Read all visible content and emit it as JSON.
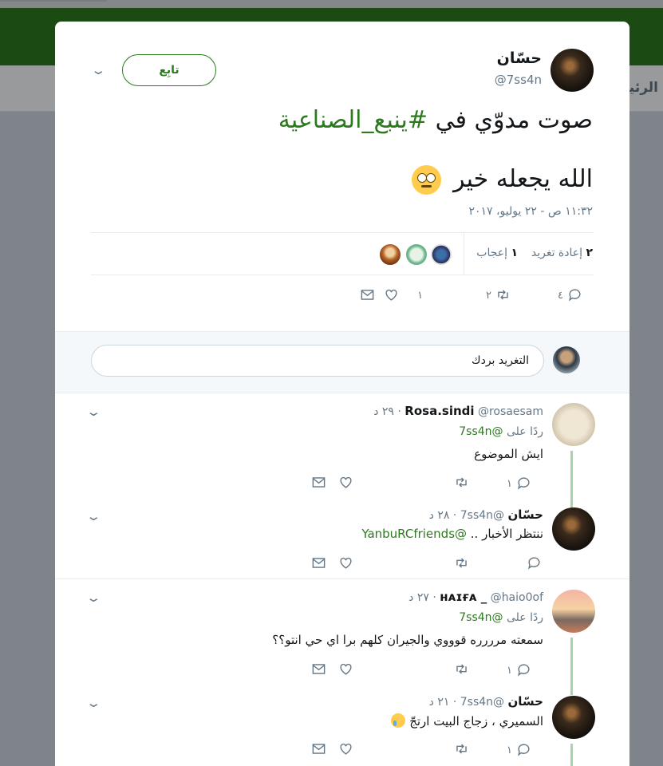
{
  "background": {
    "nav_label": "الرئيسية"
  },
  "tweet": {
    "author_name": "حسّان",
    "author_handle": "@7ss4n",
    "follow_label": "تابِع",
    "text_line1": "صوت مدوّي في ",
    "hashtag": "#ينبع_الصناعية",
    "text_line2": "الله يجعله خير",
    "timestamp": "١١:٣٢ ص - ٢٢ يوليو، ٢٠١٧",
    "retweets_count": "٢",
    "retweets_label": "إعادة تغريد",
    "likes_count": "١",
    "likes_label": "إعجاب",
    "reply_count": "٤",
    "retweet_count_action": "٢",
    "like_count_action": "١"
  },
  "reply_box": {
    "placeholder": "التغريد بردك"
  },
  "replies": [
    {
      "name": "Rosa.sindi",
      "handle": "@rosaesam",
      "time": "· ٢٩ د",
      "replying_to_label": "ردًا على",
      "replying_to": "@7ss4n",
      "text": "ايش الموضوع",
      "reply_count": "١"
    },
    {
      "name": "حسّان",
      "handle": "@7ss4n",
      "time": "· ٢٨ د",
      "text": "ننتظر الأخبار .. ",
      "mention": "@YanbuRCfriends"
    },
    {
      "name": "ʜᴀɪғᴀ _",
      "handle": "@haio0of",
      "time": "· ٢٧ د",
      "replying_to_label": "ردًا على",
      "replying_to": "@7ss4n",
      "text": "سمعته مرررره قوووي والجيران كلهم برا اي حي انتو؟؟",
      "reply_count": "١"
    },
    {
      "name": "حسّان",
      "handle": "@7ss4n",
      "time": "· ٢١ د",
      "text": "السميري ، زجاج البيت ارتجّ",
      "reply_count": "١"
    }
  ],
  "colors": {
    "accent": "#2c7a1d",
    "muted": "#657786",
    "thread": "#a5d6a7"
  },
  "icons": [
    "chevron-down-icon",
    "reply-icon",
    "retweet-icon",
    "heart-icon",
    "envelope-icon"
  ]
}
